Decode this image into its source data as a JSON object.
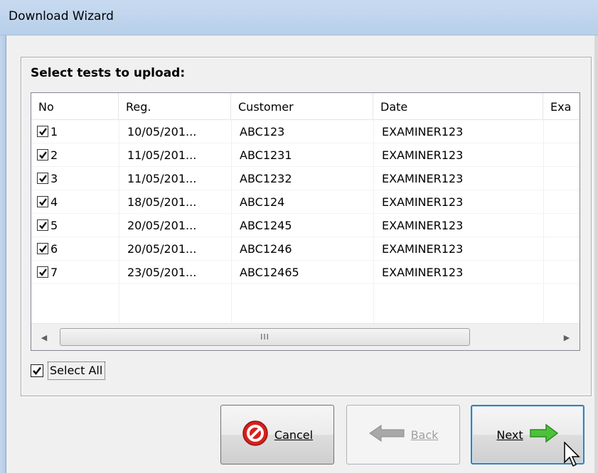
{
  "window": {
    "title": "Download Wizard"
  },
  "panel": {
    "heading": "Select tests to upload:"
  },
  "table": {
    "columns": [
      "No",
      "Reg.",
      "Customer",
      "Date",
      "Exa"
    ],
    "rows": [
      {
        "no": "1",
        "checked": true,
        "reg": "10/05/201...",
        "customer": "ABC123",
        "date": "EXAMINER123"
      },
      {
        "no": "2",
        "checked": true,
        "reg": "11/05/201...",
        "customer": "ABC1231",
        "date": "EXAMINER123"
      },
      {
        "no": "3",
        "checked": true,
        "reg": "11/05/201...",
        "customer": "ABC1232",
        "date": "EXAMINER123"
      },
      {
        "no": "4",
        "checked": true,
        "reg": "18/05/201...",
        "customer": "ABC124",
        "date": "EXAMINER123"
      },
      {
        "no": "5",
        "checked": true,
        "reg": "20/05/201...",
        "customer": "ABC1245",
        "date": "EXAMINER123"
      },
      {
        "no": "6",
        "checked": true,
        "reg": "20/05/201...",
        "customer": "ABC1246",
        "date": "EXAMINER123"
      },
      {
        "no": "7",
        "checked": true,
        "reg": "23/05/201...",
        "customer": "ABC12465",
        "date": "EXAMINER123"
      }
    ],
    "scroll_thumb_grip": "III"
  },
  "select_all": {
    "label": "Select All",
    "checked": true
  },
  "buttons": {
    "cancel": {
      "label": "Cancel",
      "icon": "cancel-icon",
      "enabled": true
    },
    "back": {
      "label": "Back",
      "icon": "back-arrow-icon",
      "enabled": false
    },
    "next": {
      "label": "Next",
      "icon": "next-arrow-icon",
      "enabled": true
    }
  },
  "colors": {
    "titlebar": "#b7cfea",
    "cancel_red": "#d8201c",
    "next_green": "#4cc23b",
    "back_gray": "#a8a8a8"
  }
}
